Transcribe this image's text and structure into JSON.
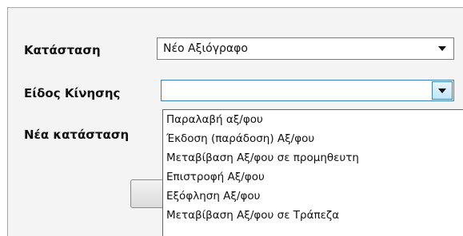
{
  "form": {
    "status_label": "Κατάσταση",
    "status_value": "Νέο Αξιόγραφο",
    "movement_type_label": "Είδος Κίνησης",
    "movement_type_value": "",
    "new_status_label": "Νέα κατάσταση"
  },
  "dropdown": {
    "options": [
      "Παραλαβή αξ/φου",
      "Έκδοση (παράδοση) Αξ/φου",
      "Μεταβίβαση Αξ/φου σε προμηθευτη",
      "Επιστροφή Αξ/φου",
      "Εξόφληση Αξ/φου",
      "Μεταβίβαση Αξ/φου σε Τράπεζα"
    ]
  },
  "colors": {
    "accent": "#3c7fb1"
  }
}
